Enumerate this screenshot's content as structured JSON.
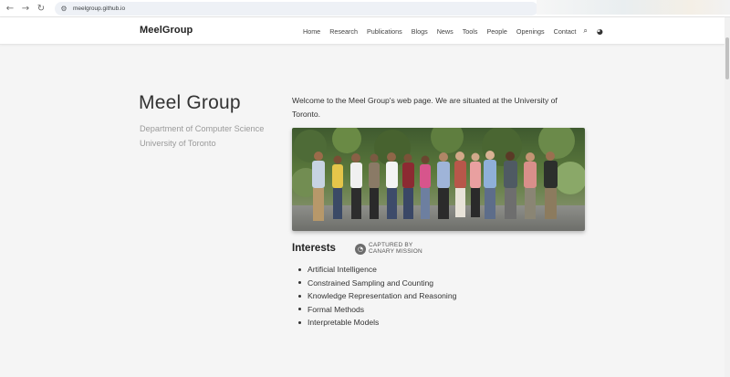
{
  "browser": {
    "url": "meelgroup.github.io",
    "back_icon": "back-arrow-icon",
    "forward_icon": "forward-arrow-icon",
    "reload_icon": "reload-icon",
    "site_info_icon": "site-info-icon"
  },
  "header": {
    "brand": "MeelGroup",
    "nav": [
      "Home",
      "Research",
      "Publications",
      "Blogs",
      "News",
      "Tools",
      "People",
      "Openings",
      "Contact"
    ],
    "search_icon": "search-icon",
    "theme_icon": "palette-icon"
  },
  "main": {
    "title": "Meel Group",
    "subtitle_line1": "Department of Computer Science",
    "subtitle_line2": "University of Toronto",
    "welcome": "Welcome to the Meel Group's web page. We are situated at the University of Toronto.",
    "interests_title": "Interests",
    "captured_line1": "CAPTURED BY",
    "captured_line2": "CANARY MISSION",
    "interests": [
      "Artificial Intelligence",
      "Constrained Sampling and Counting",
      "Knowledge Representation and Reasoning",
      "Formal Methods",
      "Interpretable Models"
    ]
  },
  "colors": {
    "page_background": "#f5f5f5",
    "header_background": "#ffffff",
    "text_primary": "#333333",
    "text_muted": "#9a9a9a"
  }
}
